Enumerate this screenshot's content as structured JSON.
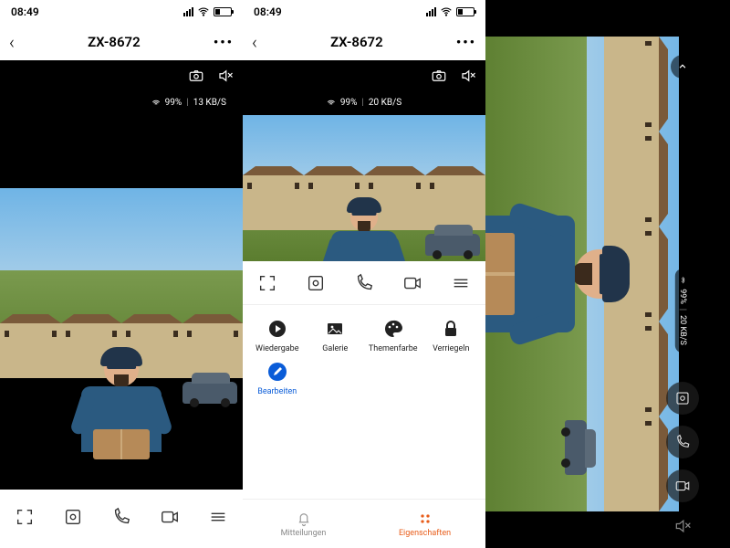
{
  "statusbar": {
    "time": "08:49"
  },
  "header": {
    "title": "ZX-8672"
  },
  "stream": {
    "signal_pct": "99%",
    "rate_a": "13 KB/S",
    "rate_b": "20 KB/S",
    "rate_c": "20 KB/S"
  },
  "features": {
    "playback": "Wiedergabe",
    "gallery": "Galerie",
    "theme": "Themenfarbe",
    "lock": "Verriegeln",
    "edit": "Bearbeiten"
  },
  "tabs": {
    "notifications": "Mitteilungen",
    "properties": "Eigenschaften"
  },
  "icons": {
    "camera": "camera-icon",
    "mute": "mute-icon",
    "fullscreen": "fullscreen-icon",
    "record": "record-icon",
    "call": "call-icon",
    "video": "video-icon",
    "options": "options-icon"
  }
}
